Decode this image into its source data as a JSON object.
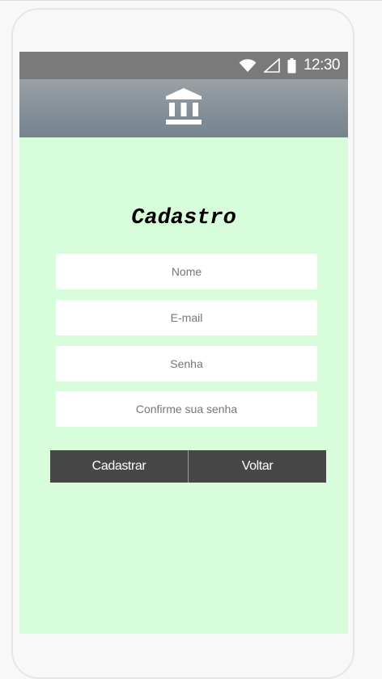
{
  "status_bar": {
    "time": "12:30",
    "icons": [
      "wifi-icon",
      "signal-icon",
      "battery-icon"
    ]
  },
  "app_bar": {
    "icon": "bank-icon"
  },
  "form": {
    "title": "Cadastro",
    "fields": [
      {
        "placeholder": "Nome",
        "value": ""
      },
      {
        "placeholder": "E-mail",
        "value": ""
      },
      {
        "placeholder": "Senha",
        "value": ""
      },
      {
        "placeholder": "Confirme sua senha",
        "value": ""
      }
    ]
  },
  "buttons": {
    "register_label": "Cadastrar",
    "back_label": "Voltar"
  },
  "colors": {
    "screen_background": "#d8fddb",
    "status_bar": "#7a7a7a",
    "app_bar": "#86919a",
    "button": "#474747"
  }
}
